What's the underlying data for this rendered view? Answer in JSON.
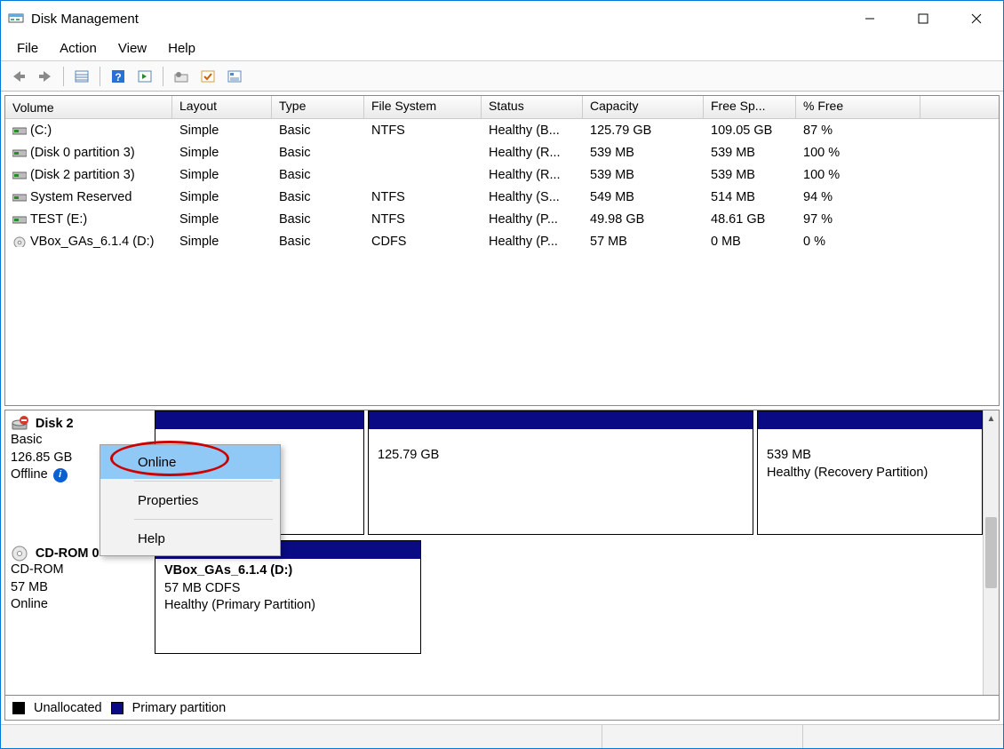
{
  "window": {
    "title": "Disk Management"
  },
  "menu": {
    "file": "File",
    "action": "Action",
    "view": "View",
    "help": "Help"
  },
  "columns": {
    "volume": "Volume",
    "layout": "Layout",
    "type": "Type",
    "fs": "File System",
    "status": "Status",
    "capacity": "Capacity",
    "free": "Free Sp...",
    "pct": "% Free"
  },
  "volumes": [
    {
      "icon": "hdd",
      "name": "(C:)",
      "layout": "Simple",
      "type": "Basic",
      "fs": "NTFS",
      "status": "Healthy (B...",
      "capacity": "125.79 GB",
      "free": "109.05 GB",
      "pct": "87 %"
    },
    {
      "icon": "hdd",
      "name": "(Disk 0 partition 3)",
      "layout": "Simple",
      "type": "Basic",
      "fs": "",
      "status": "Healthy (R...",
      "capacity": "539 MB",
      "free": "539 MB",
      "pct": "100 %"
    },
    {
      "icon": "hdd",
      "name": "(Disk 2 partition 3)",
      "layout": "Simple",
      "type": "Basic",
      "fs": "",
      "status": "Healthy (R...",
      "capacity": "539 MB",
      "free": "539 MB",
      "pct": "100 %"
    },
    {
      "icon": "hdd",
      "name": "System Reserved",
      "layout": "Simple",
      "type": "Basic",
      "fs": "NTFS",
      "status": "Healthy (S...",
      "capacity": "549 MB",
      "free": "514 MB",
      "pct": "94 %"
    },
    {
      "icon": "hdd",
      "name": "TEST (E:)",
      "layout": "Simple",
      "type": "Basic",
      "fs": "NTFS",
      "status": "Healthy (P...",
      "capacity": "49.98 GB",
      "free": "48.61 GB",
      "pct": "97 %"
    },
    {
      "icon": "cd",
      "name": "VBox_GAs_6.1.4 (D:)",
      "layout": "Simple",
      "type": "Basic",
      "fs": "CDFS",
      "status": "Healthy (P...",
      "capacity": "57 MB",
      "free": "0 MB",
      "pct": "0 %"
    }
  ],
  "disks": {
    "disk2": {
      "title": "Disk 2",
      "basic": "Basic",
      "size": "126.85 GB",
      "state": "Offline",
      "part_mid_size": "125.79 GB",
      "part_right_size": "539 MB",
      "part_right_status": "Healthy (Recovery Partition)"
    },
    "cdrom0": {
      "title": "CD-ROM 0",
      "type": "CD-ROM",
      "size": "57 MB",
      "state": "Online",
      "vol_title": "VBox_GAs_6.1.4  (D:)",
      "vol_line2": "57 MB CDFS",
      "vol_line3": "Healthy (Primary Partition)"
    }
  },
  "context_menu": {
    "online": "Online",
    "properties": "Properties",
    "help": "Help"
  },
  "legend": {
    "unallocated": "Unallocated",
    "primary": "Primary partition"
  }
}
